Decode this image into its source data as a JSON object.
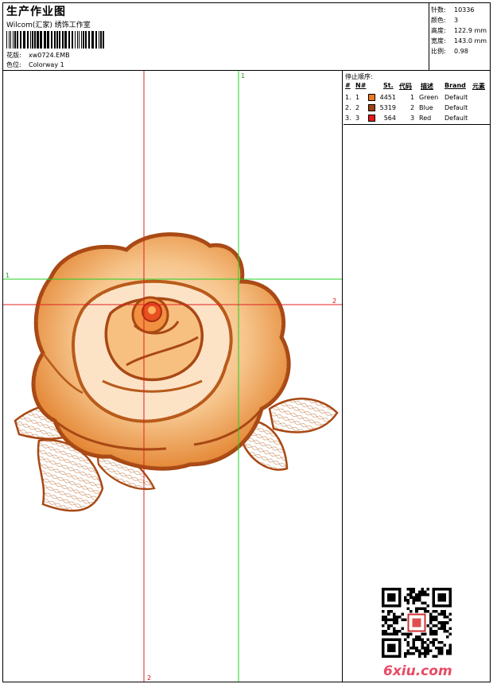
{
  "header": {
    "title": "生产作业图",
    "company": "Wilcom(汇家) 绣饰工作室",
    "design_label": "花版:",
    "design_value": "xw0724.EMB",
    "colorway_label": "色位:",
    "colorway_value": "Colorway 1"
  },
  "stats": [
    {
      "key": "针数:",
      "value": "10336"
    },
    {
      "key": "颜色:",
      "value": "3"
    },
    {
      "key": "高度:",
      "value": "122.9 mm"
    },
    {
      "key": "宽度:",
      "value": "143.0 mm"
    },
    {
      "key": "比例:",
      "value": "0.98"
    }
  ],
  "guides": {
    "green_v_label": "1",
    "green_h_label": "1",
    "red_h_label": "2",
    "red_v_label": "2"
  },
  "stop_sequence": {
    "title": "停止顺序:",
    "columns": [
      "#",
      "N#",
      "St.",
      "代码",
      "描述",
      "Brand",
      "元素"
    ],
    "rows": [
      {
        "idx": "1.",
        "n": "1",
        "color": "#f07820",
        "st": "4451",
        "code": "1",
        "desc": "Green",
        "brand": "Default"
      },
      {
        "idx": "2.",
        "n": "2",
        "color": "#a04010",
        "st": "5319",
        "code": "2",
        "desc": "Blue",
        "brand": "Default"
      },
      {
        "idx": "3.",
        "n": "3",
        "color": "#e81818",
        "st": "564",
        "code": "3",
        "desc": "Red",
        "brand": "Default"
      }
    ]
  },
  "watermark": "6xiu.com",
  "colors": {
    "guide_red": "#e02020",
    "guide_green": "#20d020",
    "rose_dark": "#a84814",
    "rose_mid": "#e07a24",
    "rose_light": "#f4b060"
  }
}
